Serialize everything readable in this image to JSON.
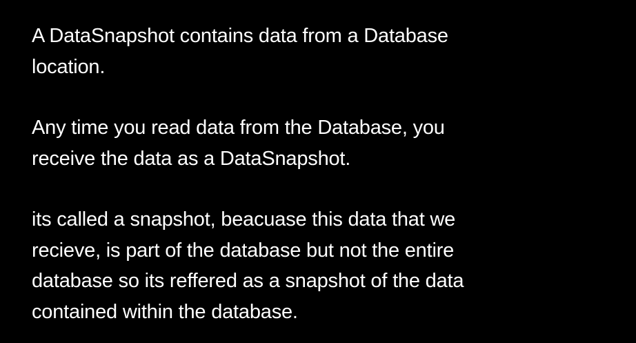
{
  "paragraphs": [
    {
      "lines": [
        "A DataSnapshot contains data from a Database",
        "location."
      ]
    },
    {
      "lines": [
        "Any time you read data from the Database, you",
        "receive the data as a DataSnapshot."
      ]
    },
    {
      "lines": [
        "its called a snapshot, beacuase this data that we",
        "recieve, is part of the database but not the entire",
        "database so its reffered as a snapshot of the data",
        "contained within the database."
      ]
    }
  ],
  "colors": {
    "background": "#000000",
    "text": "#ffffff"
  }
}
